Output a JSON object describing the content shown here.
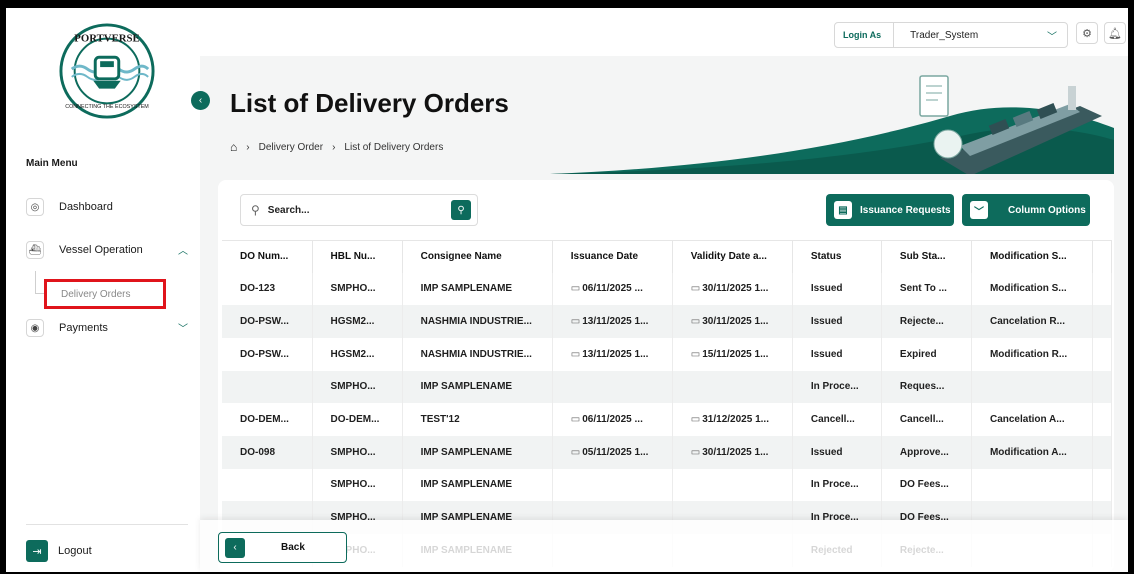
{
  "brand": {
    "name": "PORTVERSE",
    "tagline": "CONNECTING THE ECOSYSTEM",
    "accent": "#0d6b5c"
  },
  "sidebar": {
    "heading": "Main Menu",
    "items": [
      {
        "label": "Dashboard",
        "icon": "dashboard-icon"
      },
      {
        "label": "Vessel Operation",
        "icon": "ship-icon"
      },
      {
        "label": "Payments",
        "icon": "payments-icon"
      }
    ],
    "sub_item": "Delivery Orders",
    "logout": "Logout"
  },
  "topbar": {
    "login_label": "Login As",
    "login_value": "Trader_System"
  },
  "header": {
    "title": "List of Delivery Orders",
    "breadcrumb": [
      "Delivery Order",
      "List of Delivery Orders"
    ]
  },
  "toolbar": {
    "search_placeholder": "Search...",
    "issuance_requests": "Issuance Requests",
    "column_options": "Column Options"
  },
  "table": {
    "columns": [
      "DO Num...",
      "HBL Nu...",
      "Consignee Name",
      "Issuance Date",
      "Validity Date a...",
      "Status",
      "Sub Sta...",
      "Modification S..."
    ],
    "rows": [
      [
        "DO-123",
        "SMPHO...",
        "IMP SAMPLENAME",
        "06/11/2025 ...",
        "30/11/2025 1...",
        "Issued",
        "Sent To ...",
        "Modification S..."
      ],
      [
        "DO-PSW...",
        "HGSM2...",
        "NASHMIA INDUSTRIE...",
        "13/11/2025 1...",
        "30/11/2025 1...",
        "Issued",
        "Rejecte...",
        "Cancelation R..."
      ],
      [
        "DO-PSW...",
        "HGSM2...",
        "NASHMIA INDUSTRIE...",
        "13/11/2025 1...",
        "15/11/2025 1...",
        "Issued",
        "Expired",
        "Modification R..."
      ],
      [
        "",
        "SMPHO...",
        "IMP SAMPLENAME",
        "",
        "",
        "In Proce...",
        "Reques...",
        ""
      ],
      [
        "DO-DEM...",
        "DO-DEM...",
        "TEST'12",
        "06/11/2025 ...",
        "31/12/2025 1...",
        "Cancell...",
        "Cancell...",
        "Cancelation A..."
      ],
      [
        "DO-098",
        "SMPHO...",
        "IMP SAMPLENAME",
        "05/11/2025 1...",
        "30/11/2025 1...",
        "Issued",
        "Approve...",
        "Modification A..."
      ],
      [
        "",
        "SMPHO...",
        "IMP SAMPLENAME",
        "",
        "",
        "In Proce...",
        "DO Fees...",
        ""
      ],
      [
        "",
        "SMPHO...",
        "IMP SAMPLENAME",
        "",
        "",
        "In Proce...",
        "DO Fees...",
        ""
      ],
      [
        "",
        "SMPHO...",
        "IMP SAMPLENAME",
        "",
        "",
        "Rejected",
        "Rejecte...",
        ""
      ]
    ]
  },
  "footer": {
    "back": "Back"
  }
}
